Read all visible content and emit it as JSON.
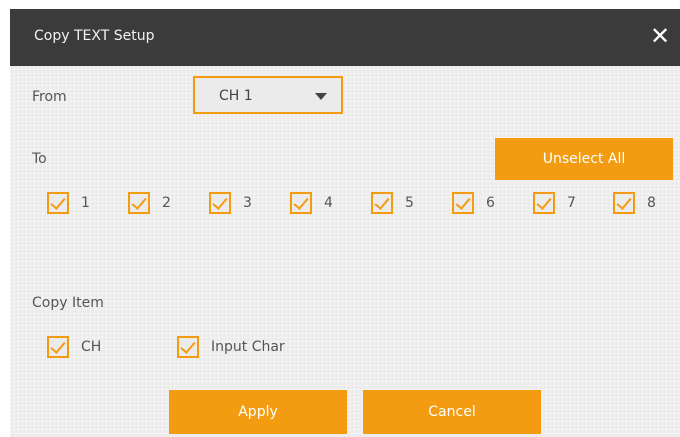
{
  "dialog": {
    "title": "Copy TEXT Setup",
    "close_glyph": "✕"
  },
  "from": {
    "label": "From",
    "selected": "CH 1"
  },
  "to": {
    "label": "To",
    "unselect_all_label": "Unselect All",
    "channels": [
      {
        "label": "1",
        "checked": true
      },
      {
        "label": "2",
        "checked": true
      },
      {
        "label": "3",
        "checked": true
      },
      {
        "label": "4",
        "checked": true
      },
      {
        "label": "5",
        "checked": true
      },
      {
        "label": "6",
        "checked": true
      },
      {
        "label": "7",
        "checked": true
      },
      {
        "label": "8",
        "checked": true
      }
    ]
  },
  "copy_item": {
    "label": "Copy Item",
    "items": [
      {
        "label": "CH",
        "checked": true
      },
      {
        "label": "Input Char",
        "checked": true
      }
    ]
  },
  "footer": {
    "apply_label": "Apply",
    "cancel_label": "Cancel"
  },
  "colors": {
    "accent": "#f39c12",
    "titlebar": "#3b3b3b",
    "background": "#ebebeb"
  }
}
